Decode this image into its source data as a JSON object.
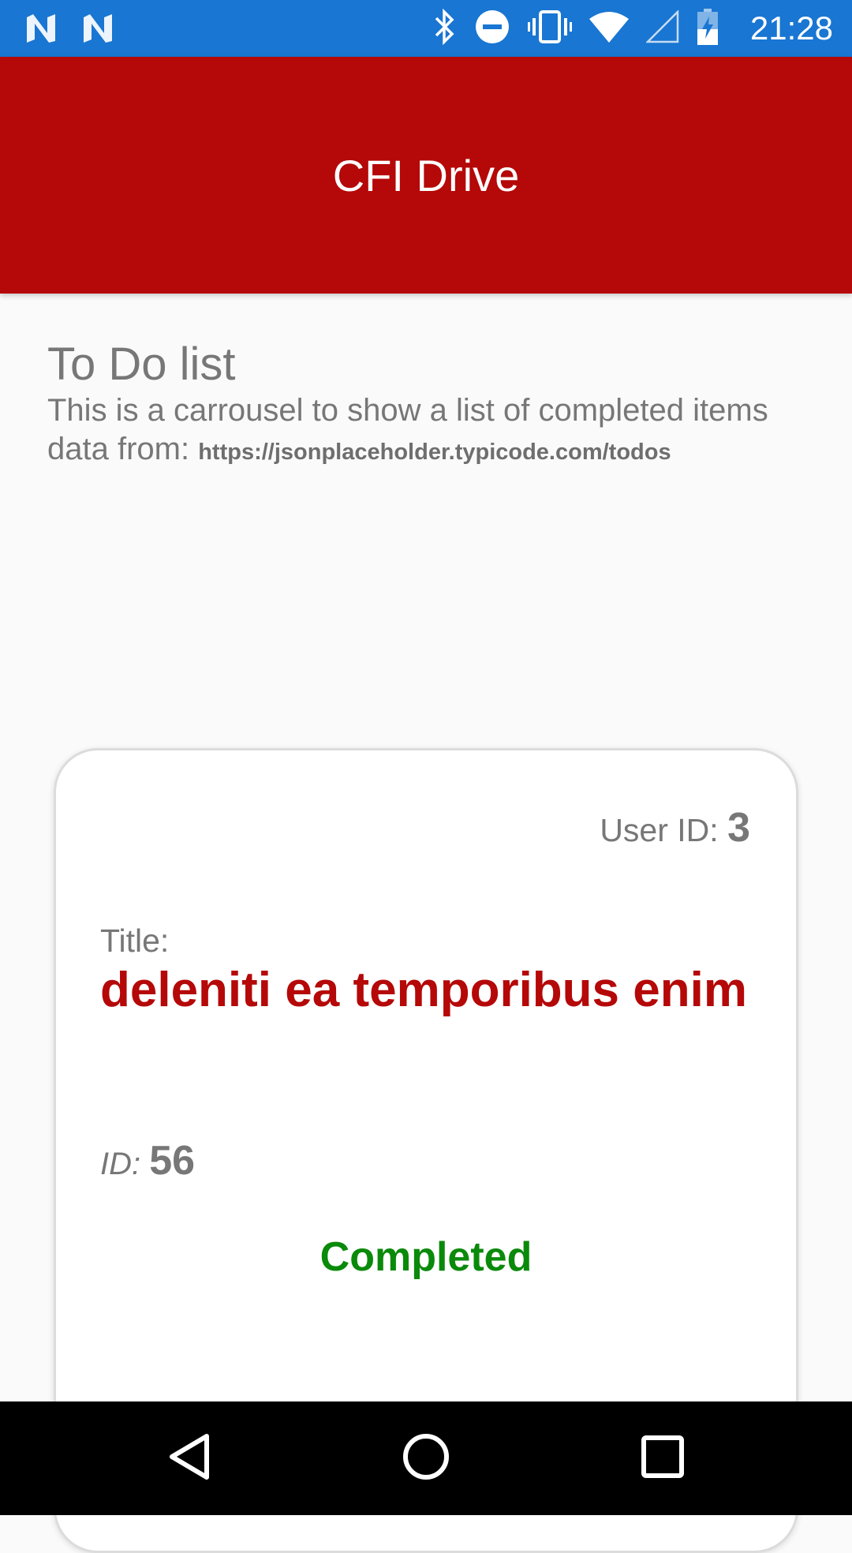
{
  "status_bar": {
    "time": "21:28",
    "background": "#1976d2",
    "left_icons": [
      "notification-n-icon",
      "notification-n-icon"
    ],
    "right_icons": [
      "bluetooth-icon",
      "do-not-disturb-icon",
      "vibrate-icon",
      "wifi-icon",
      "cell-signal-icon",
      "battery-charging-icon"
    ]
  },
  "app_bar": {
    "title": "CFI Drive",
    "background": "#b50808"
  },
  "intro": {
    "heading": "To Do list",
    "description": "This is a carrousel to show a list of completed items",
    "data_from_label": "data from: ",
    "data_url": "https://jsonplaceholder.typicode.com/todos"
  },
  "card": {
    "user_id_label": "User ID: ",
    "user_id_value": "3",
    "title_label": "Title:",
    "title_value": "deleniti ea temporibus enim",
    "id_label": "ID: ",
    "id_value": "56",
    "status": "Completed",
    "title_color": "#b50808",
    "status_color": "#0a8a0a"
  },
  "nav_bar": {
    "buttons": [
      "back-icon",
      "home-icon",
      "recents-icon"
    ]
  }
}
